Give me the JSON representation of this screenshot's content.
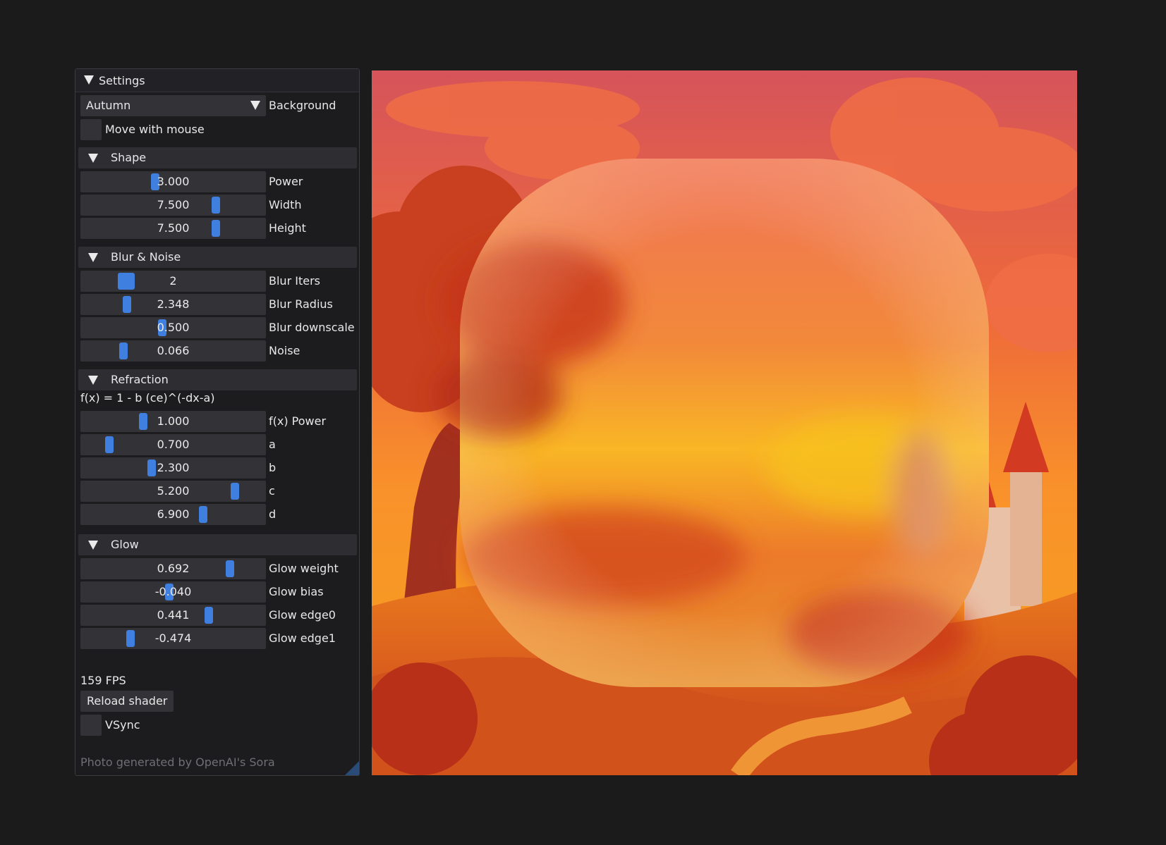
{
  "settings": {
    "title": "Settings",
    "background_value": "Autumn",
    "background_label": "Background",
    "move_with_mouse_label": "Move with mouse",
    "shape": {
      "header": "Shape",
      "power": {
        "value": "3.000",
        "label": "Power",
        "level": 0.4
      },
      "width": {
        "value": "7.500",
        "label": "Width",
        "level": 0.74
      },
      "height": {
        "value": "7.500",
        "label": "Height",
        "level": 0.74
      }
    },
    "blur_noise": {
      "header": "Blur & Noise",
      "blur_iters": {
        "value": "2",
        "label": "Blur Iters",
        "level": 0.22
      },
      "blur_radius": {
        "value": "2.348",
        "label": "Blur Radius",
        "level": 0.24
      },
      "blur_downscale": {
        "value": "0.500",
        "label": "Blur downscale",
        "level": 0.44
      },
      "noise": {
        "value": "0.066",
        "label": "Noise",
        "level": 0.22
      }
    },
    "refraction": {
      "header": "Refraction",
      "formula": "f(x) = 1 - b (ce)^(-dx-a)",
      "fx_power": {
        "value": "1.000",
        "label": "f(x) Power",
        "level": 0.33
      },
      "a": {
        "value": "0.700",
        "label": "a",
        "level": 0.14
      },
      "b": {
        "value": "2.300",
        "label": "b",
        "level": 0.38
      },
      "c": {
        "value": "5.200",
        "label": "c",
        "level": 0.85
      },
      "d": {
        "value": "6.900",
        "label": "d",
        "level": 0.67
      }
    },
    "glow": {
      "header": "Glow",
      "glow_weight": {
        "value": "0.692",
        "label": "Glow weight",
        "level": 0.82
      },
      "glow_bias": {
        "value": "-0.040",
        "label": "Glow bias",
        "level": 0.48
      },
      "glow_edge0": {
        "value": "0.441",
        "label": "Glow edge0",
        "level": 0.7
      },
      "glow_edge1": {
        "value": "-0.474",
        "label": "Glow edge1",
        "level": 0.26
      }
    },
    "fps": "159 FPS",
    "reload_shader": "Reload shader",
    "vsync_label": "VSync",
    "credit": "Photo generated by OpenAI's Sora"
  },
  "colors": {
    "accent": "#3f7fe0",
    "panel_bg": "#1c1c1e",
    "frame_bg": "#333337",
    "header_bg": "#2d2d32"
  }
}
